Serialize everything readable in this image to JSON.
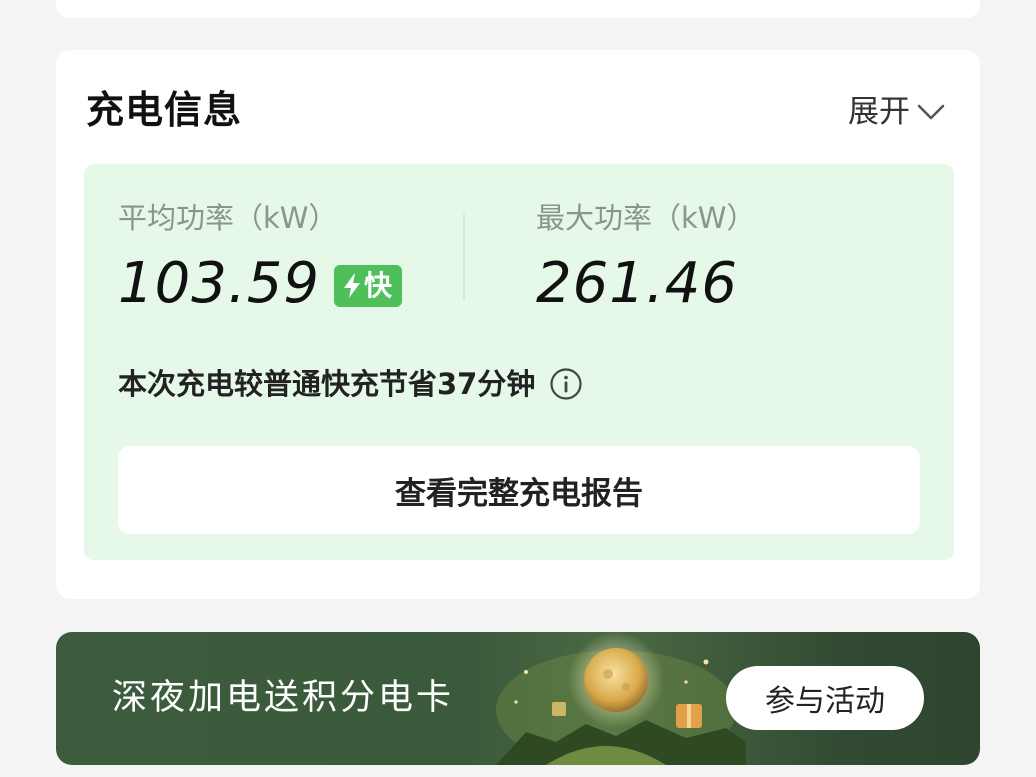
{
  "charging_info": {
    "title": "充电信息",
    "expand_label": "展开",
    "avg_power": {
      "label": "平均功率（kW）",
      "value": "103.59",
      "badge": "快"
    },
    "max_power": {
      "label": "最大功率（kW）",
      "value": "261.46"
    },
    "saving_text": "本次充电较普通快充节省37分钟",
    "report_button": "查看完整充电报告"
  },
  "promo": {
    "text": "深夜加电送积分电卡",
    "button": "参与活动"
  },
  "icons": {
    "expand": "chevron-down-icon",
    "badge": "lightning-icon",
    "info": "info-circle-icon"
  },
  "colors": {
    "panel_bg": "#e6f8e8",
    "badge_green": "#4fbf5a",
    "promo_bg": "#3a5a3b"
  }
}
